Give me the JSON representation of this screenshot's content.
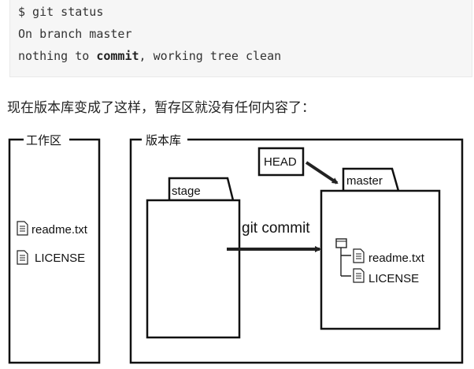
{
  "code": {
    "line1": "$ git status",
    "line2": "On branch master",
    "line3_prefix": "nothing to ",
    "line3_keyword": "commit",
    "line3_suffix": ", working tree clean"
  },
  "paragraph": "现在版本库变成了这样，暂存区就没有任何内容了：",
  "diagram": {
    "working_dir_title": "工作区",
    "repo_title": "版本库",
    "head_label": "HEAD",
    "stage_label": "stage",
    "master_label": "master",
    "commit_label": "git commit",
    "working_files": [
      "readme.txt",
      "LICENSE"
    ],
    "master_files": [
      "readme.txt",
      "LICENSE"
    ]
  }
}
